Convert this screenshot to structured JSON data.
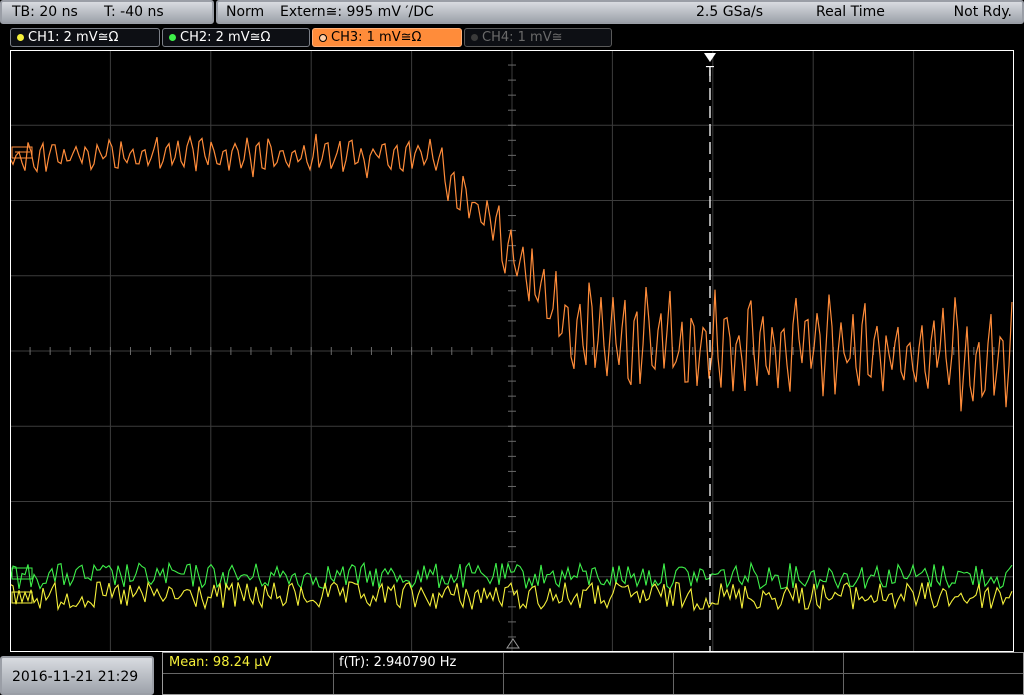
{
  "header": {
    "timebase": "TB: 20 ns",
    "offset": "T: -40 ns",
    "mode": "Norm",
    "trigger": "Extern≅: 995 mV ′/DC",
    "sample_rate": "2.5 GSa/s",
    "acq_mode": "Real Time",
    "status": "Not Rdy."
  },
  "channels": [
    {
      "label": "CH1: 2 mV≅Ω",
      "color": "#f5f03a",
      "active": true
    },
    {
      "label": "CH2: 2 mV≅Ω",
      "color": "#3ef04a",
      "active": true
    },
    {
      "label": "CH3: 1 mV≅Ω",
      "color": "#ff8c3a",
      "active": true
    },
    {
      "label": "CH4: 1 mV≅",
      "color": "#777777",
      "active": false
    }
  ],
  "trigger_marker": "T",
  "footer": {
    "datetime": "2016-11-21 21:29",
    "measure1": "Mean: 98.24 µV",
    "measure2": "f(Tr): 2.940790 Hz"
  },
  "colors": {
    "ch1": "#f5f03a",
    "ch2": "#3ef04a",
    "ch3": "#ff8c3a",
    "grid": "#4a4a4a",
    "frame": "#ffffff"
  }
}
